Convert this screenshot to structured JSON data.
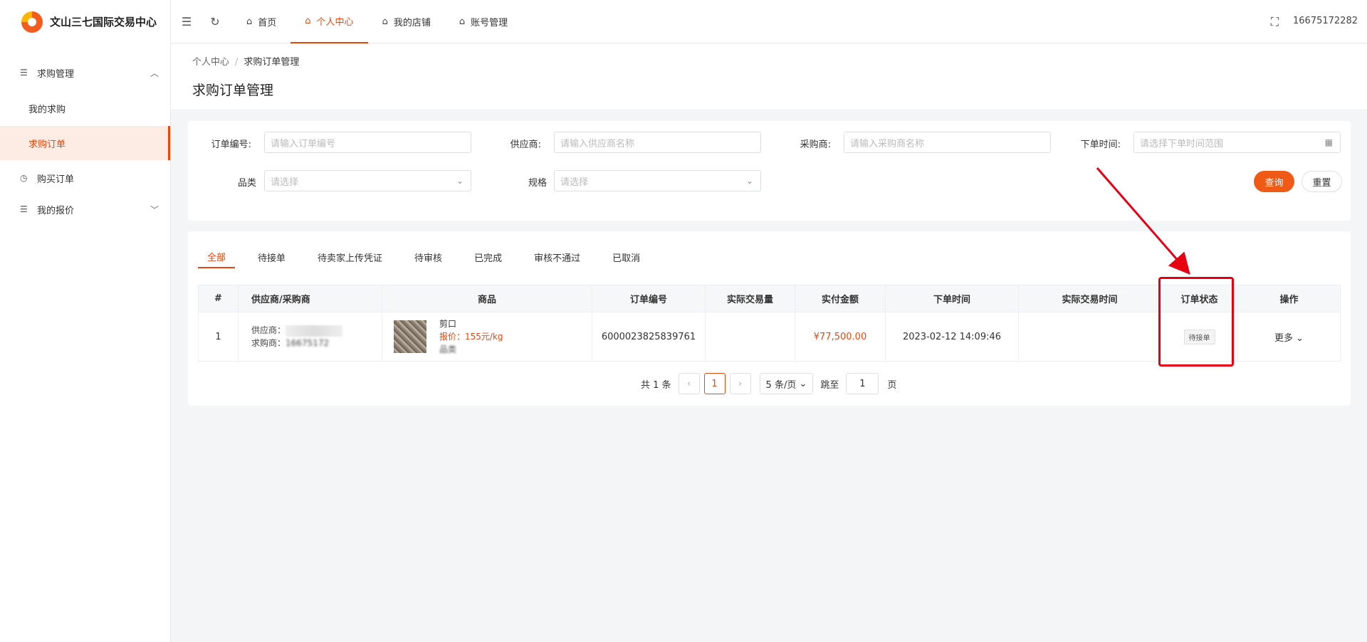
{
  "app": {
    "name": "文山三七国际交易中心"
  },
  "header": {
    "tabs": [
      {
        "label": "首页"
      },
      {
        "label": "个人中心"
      },
      {
        "label": "我的店铺"
      },
      {
        "label": "账号管理"
      }
    ],
    "user": "16675172282"
  },
  "sidebar": {
    "groups": [
      {
        "label": "求购管理"
      },
      {
        "label": "购买订单"
      },
      {
        "label": "我的报价"
      }
    ],
    "subs": [
      {
        "label": "我的求购"
      },
      {
        "label": "求购订单"
      }
    ]
  },
  "breadcrumb": {
    "root": "个人中心",
    "sep": "/",
    "current": "求购订单管理"
  },
  "page_title": "求购订单管理",
  "filters": {
    "order_no": {
      "label": "订单编号:",
      "placeholder": "请输入订单编号"
    },
    "supplier": {
      "label": "供应商:",
      "placeholder": "请输入供应商名称"
    },
    "buyer": {
      "label": "采购商:",
      "placeholder": "请输入采购商名称"
    },
    "time": {
      "label": "下单时间:",
      "placeholder": "请选择下单时间范围"
    },
    "category": {
      "label": "品类",
      "placeholder": "请选择"
    },
    "spec": {
      "label": "规格",
      "placeholder": "请选择"
    },
    "query_btn": "查询",
    "reset_btn": "重置"
  },
  "status_tabs": [
    "全部",
    "待接单",
    "待卖家上传凭证",
    "待审核",
    "已完成",
    "审核不通过",
    "已取消"
  ],
  "table": {
    "columns": [
      "#",
      "供应商/采购商",
      "商品",
      "订单编号",
      "实际交易量",
      "实付金额",
      "下单时间",
      "实际交易时间",
      "订单状态",
      "操作"
    ],
    "rows": [
      {
        "index": "1",
        "supplier_label": "供应商：",
        "buyer_label": "求购商：",
        "buyer_value": "16675172",
        "product_name": "剪口",
        "product_price": "报价：155元/kg",
        "product_cat": "品类",
        "order_no": "6000023825839761",
        "actual_qty": "",
        "amount": "¥77,500.00",
        "order_time": "2023-02-12 14:09:46",
        "trade_time": "",
        "status": "待接单",
        "action": "更多"
      }
    ]
  },
  "pagination": {
    "total": "共 1 条",
    "current": "1",
    "size": "5 条/页",
    "jump": "跳至",
    "jump_value": "1",
    "unit": "页"
  }
}
